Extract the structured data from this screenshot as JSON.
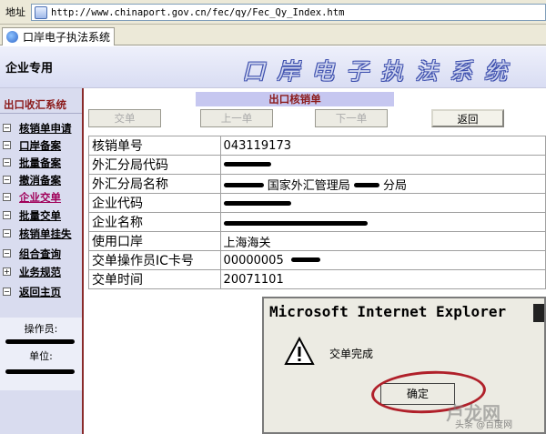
{
  "address_bar": {
    "label": "地址",
    "url": "http://www.chinaport.gov.cn/fec/qy/Fec_Qy_Index.htm"
  },
  "tab": {
    "title": "口岸电子执法系统"
  },
  "header": {
    "left_label": "企业专用",
    "title": "口岸电子执法系统"
  },
  "sidebar": {
    "section_title": "出口收汇系统",
    "items": [
      {
        "label": "核销单申请",
        "icon": "minus"
      },
      {
        "label": "口岸备案",
        "icon": "minus"
      },
      {
        "label": "批量备案",
        "icon": "minus"
      },
      {
        "label": "撤消备案",
        "icon": "minus"
      },
      {
        "label": "企业交单",
        "icon": "minus",
        "active": true
      },
      {
        "label": "批量交单",
        "icon": "minus"
      },
      {
        "label": "核销单挂失",
        "icon": "minus"
      },
      {
        "label": "组合查询",
        "icon": "minus"
      },
      {
        "label": "业务规范",
        "icon": "plus"
      },
      {
        "label": "返回主页",
        "icon": "minus"
      }
    ],
    "operator_label": "操作员:",
    "unit_label": "单位:"
  },
  "form": {
    "title": "出口核销单",
    "buttons": {
      "submit": "交单",
      "prev": "上一单",
      "next": "下一单",
      "back": "返回"
    },
    "rows": [
      {
        "label": "核销单号",
        "value": "043119173"
      },
      {
        "label": "外汇分局代码",
        "value": ""
      },
      {
        "label": "外汇分局名称",
        "value_mid": "国家外汇管理局",
        "value_end": "分局"
      },
      {
        "label": "企业代码",
        "value": ""
      },
      {
        "label": "企业名称",
        "value": ""
      },
      {
        "label": "使用口岸",
        "value": "上海海关"
      },
      {
        "label": "交单操作员IC卡号",
        "value": "00000005"
      },
      {
        "label": "交单时间",
        "value": "20071101"
      }
    ]
  },
  "dialog": {
    "title": "Microsoft Internet Explorer",
    "message": "交单完成",
    "ok_label": "确定"
  },
  "watermark": {
    "main": "卢龙网",
    "sub": "头条 @百度网"
  },
  "colors": {
    "accent": "#8b1a1a",
    "sidebar_bg": "#d9dcef",
    "header_bg": "#c6c7f0",
    "highlight_circle": "#b0202a"
  }
}
